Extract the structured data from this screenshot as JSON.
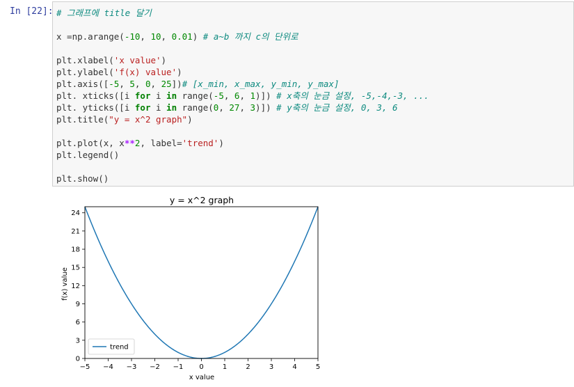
{
  "cell": {
    "prompt": "In [22]:",
    "lines": [
      [
        {
          "t": "# 그래프에 title 달기",
          "c": "cm"
        }
      ],
      [],
      [
        {
          "t": "x =np.arange(",
          "c": "plain"
        },
        {
          "t": "-10",
          "c": "num"
        },
        {
          "t": ", ",
          "c": "plain"
        },
        {
          "t": "10",
          "c": "num"
        },
        {
          "t": ", ",
          "c": "plain"
        },
        {
          "t": "0.01",
          "c": "num"
        },
        {
          "t": ") ",
          "c": "plain"
        },
        {
          "t": "# a~b 까지 c의 단위로",
          "c": "cm"
        }
      ],
      [],
      [
        {
          "t": "plt.xlabel(",
          "c": "plain"
        },
        {
          "t": "'x value'",
          "c": "str"
        },
        {
          "t": ")",
          "c": "plain"
        }
      ],
      [
        {
          "t": "plt.ylabel(",
          "c": "plain"
        },
        {
          "t": "'f(x) value'",
          "c": "str"
        },
        {
          "t": ")",
          "c": "plain"
        }
      ],
      [
        {
          "t": "plt.axis([",
          "c": "plain"
        },
        {
          "t": "-5",
          "c": "num"
        },
        {
          "t": ", ",
          "c": "plain"
        },
        {
          "t": "5",
          "c": "num"
        },
        {
          "t": ", ",
          "c": "plain"
        },
        {
          "t": "0",
          "c": "num"
        },
        {
          "t": ", ",
          "c": "plain"
        },
        {
          "t": "25",
          "c": "num"
        },
        {
          "t": "])",
          "c": "plain"
        },
        {
          "t": "# [x_min, x_max, y_min, y_max]",
          "c": "cm"
        }
      ],
      [
        {
          "t": "plt. xticks([i ",
          "c": "plain"
        },
        {
          "t": "for",
          "c": "kw"
        },
        {
          "t": " i ",
          "c": "plain"
        },
        {
          "t": "in",
          "c": "kw"
        },
        {
          "t": " range(",
          "c": "plain"
        },
        {
          "t": "-5",
          "c": "num"
        },
        {
          "t": ", ",
          "c": "plain"
        },
        {
          "t": "6",
          "c": "num"
        },
        {
          "t": ", ",
          "c": "plain"
        },
        {
          "t": "1",
          "c": "num"
        },
        {
          "t": ")]) ",
          "c": "plain"
        },
        {
          "t": "# x축의 눈금 설정, -5,-4,-3, ...",
          "c": "cm"
        }
      ],
      [
        {
          "t": "plt. yticks([i ",
          "c": "plain"
        },
        {
          "t": "for",
          "c": "kw"
        },
        {
          "t": " i ",
          "c": "plain"
        },
        {
          "t": "in",
          "c": "kw"
        },
        {
          "t": " range(",
          "c": "plain"
        },
        {
          "t": "0",
          "c": "num"
        },
        {
          "t": ", ",
          "c": "plain"
        },
        {
          "t": "27",
          "c": "num"
        },
        {
          "t": ", ",
          "c": "plain"
        },
        {
          "t": "3",
          "c": "num"
        },
        {
          "t": ")]) ",
          "c": "plain"
        },
        {
          "t": "# y축의 눈금 설정, 0, 3, 6",
          "c": "cm"
        }
      ],
      [
        {
          "t": "plt.title(",
          "c": "plain"
        },
        {
          "t": "\"y = x^2 graph\"",
          "c": "str"
        },
        {
          "t": ")",
          "c": "plain"
        }
      ],
      [],
      [
        {
          "t": "plt.plot(x, x",
          "c": "plain"
        },
        {
          "t": "**",
          "c": "op"
        },
        {
          "t": "2",
          "c": "num"
        },
        {
          "t": ", label=",
          "c": "plain"
        },
        {
          "t": "'trend'",
          "c": "str"
        },
        {
          "t": ")",
          "c": "plain"
        }
      ],
      [
        {
          "t": "plt.legend()",
          "c": "plain"
        }
      ],
      [],
      [
        {
          "t": "plt.show()",
          "c": "plain"
        }
      ]
    ]
  },
  "chart_data": {
    "type": "line",
    "title": "y = x^2 graph",
    "xlabel": "x value",
    "ylabel": "f(x) value",
    "xlim": [
      -5,
      5
    ],
    "ylim": [
      0,
      25
    ],
    "xticks": [
      -5,
      -4,
      -3,
      -2,
      -1,
      0,
      1,
      2,
      3,
      4,
      5
    ],
    "yticks": [
      0,
      3,
      6,
      9,
      12,
      15,
      18,
      21,
      24
    ],
    "series": [
      {
        "name": "trend",
        "function": "x^2",
        "x_range": [
          -10,
          10
        ],
        "step": 0.01,
        "color": "#1f77b4"
      }
    ],
    "legend_position": "lower-left",
    "grid": false
  }
}
